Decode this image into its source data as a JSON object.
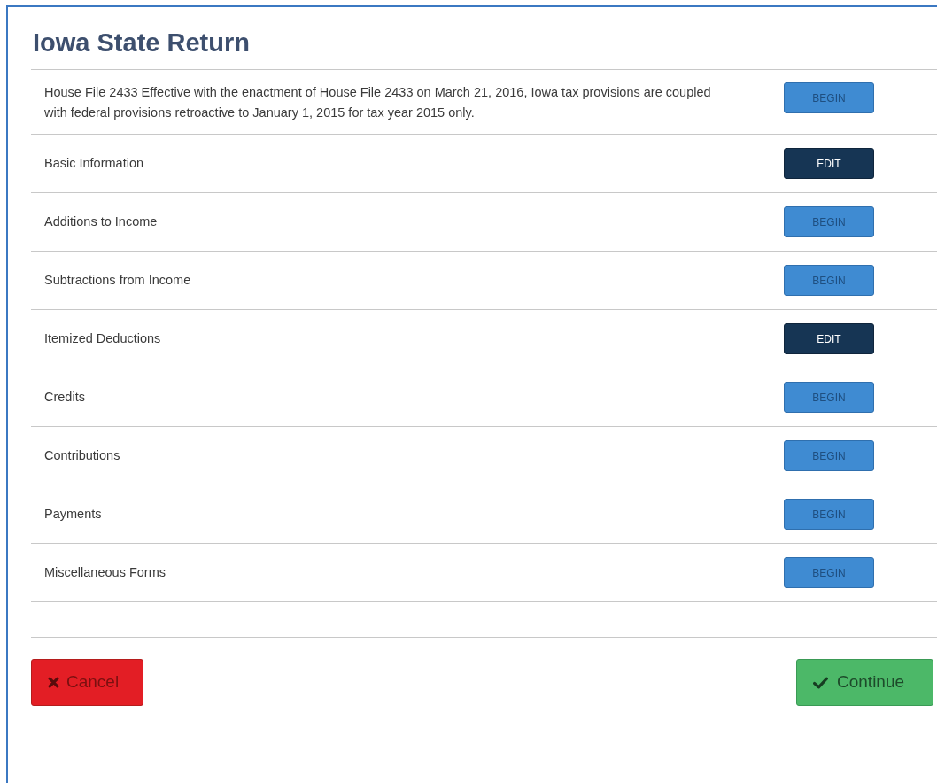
{
  "title": "Iowa State Return",
  "sections": [
    {
      "label": "House File 2433 Effective with the enactment of House File 2433 on March 21, 2016, Iowa tax provisions are coupled with federal provisions retroactive to January 1, 2015 for tax year 2015 only.",
      "button": {
        "kind": "begin",
        "label": "BEGIN"
      }
    },
    {
      "label": "Basic Information",
      "button": {
        "kind": "edit",
        "label": "EDIT"
      }
    },
    {
      "label": "Additions to Income",
      "button": {
        "kind": "begin",
        "label": "BEGIN"
      }
    },
    {
      "label": "Subtractions from Income",
      "button": {
        "kind": "begin",
        "label": "BEGIN"
      }
    },
    {
      "label": "Itemized Deductions",
      "button": {
        "kind": "edit",
        "label": "EDIT"
      }
    },
    {
      "label": "Credits",
      "button": {
        "kind": "begin",
        "label": "BEGIN"
      }
    },
    {
      "label": "Contributions",
      "button": {
        "kind": "begin",
        "label": "BEGIN"
      }
    },
    {
      "label": "Payments",
      "button": {
        "kind": "begin",
        "label": "BEGIN"
      }
    },
    {
      "label": "Miscellaneous Forms",
      "button": {
        "kind": "begin",
        "label": "BEGIN"
      }
    }
  ],
  "footer": {
    "cancel": "Cancel",
    "continue": "Continue"
  }
}
